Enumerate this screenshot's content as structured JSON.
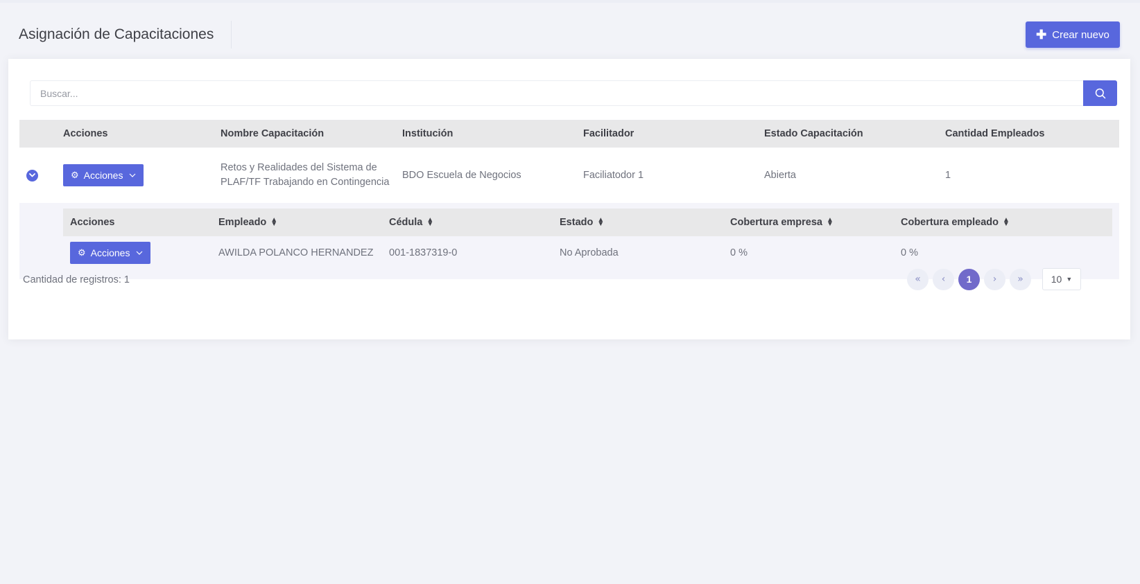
{
  "header": {
    "title": "Asignación de Capacitaciones",
    "create_label": "Crear nuevo"
  },
  "search": {
    "placeholder": "Buscar..."
  },
  "table": {
    "columns": [
      "Acciones",
      "Nombre Capacitación",
      "Institución",
      "Facilitador",
      "Estado Capacitación",
      "Cantidad Empleados"
    ],
    "rows": [
      {
        "actions_label": "Acciones",
        "nombre": "Retos y Realidades del Sistema de PLAF/TF Trabajando en Contingencia",
        "institucion": "BDO Escuela de Negocios",
        "facilitador": "Faciliatodor 1",
        "estado": "Abierta",
        "cantidad": "1"
      }
    ]
  },
  "subtable": {
    "columns": [
      "Acciones",
      "Empleado",
      "Cédula",
      "Estado",
      "Cobertura empresa",
      "Cobertura empleado"
    ],
    "rows": [
      {
        "actions_label": "Acciones",
        "empleado": "AWILDA POLANCO HERNANDEZ",
        "cedula": "001-1837319-0",
        "estado": "No Aprobada",
        "cob_empresa": "0 %",
        "cob_empleado": "0 %"
      }
    ]
  },
  "footer": {
    "count_text": "Cantidad de registros: 1",
    "current_page": "1",
    "page_size": "10"
  },
  "colors": {
    "primary": "#5867dd",
    "active_page": "#716aca",
    "background": "#f2f3f8"
  }
}
